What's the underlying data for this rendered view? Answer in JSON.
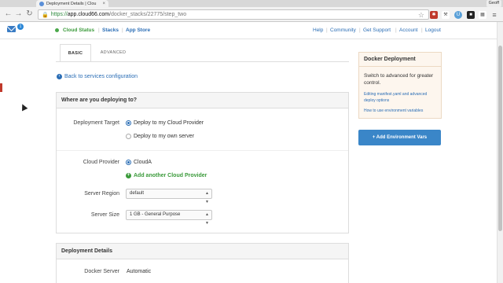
{
  "browser": {
    "tab_title": "Deployment Details | Clou",
    "tab_close": "×",
    "user_name": "Geoff",
    "url_scheme": "https://",
    "url_host": "app.cloud66.com",
    "url_path": "/docker_stacks/22775/step_two"
  },
  "header": {
    "mail_count": "1",
    "left_nav": [
      "Cloud Status",
      "Stacks",
      "App Store"
    ],
    "right_nav": [
      "Help",
      "Community",
      "Get Support",
      "Account",
      "Logout"
    ]
  },
  "tabs": {
    "basic": "BASIC",
    "advanced": "ADVANCED"
  },
  "back_link": "Back to services configuration",
  "deploy_panel": {
    "title": "Where are you deploying to?",
    "target_label": "Deployment Target",
    "target_options": [
      "Deploy to my Cloud Provider",
      "Deploy to my own server"
    ],
    "provider_label": "Cloud Provider",
    "provider_option": "CloudA",
    "add_provider": "Add another Cloud Provider",
    "region_label": "Server Region",
    "region_value": "default",
    "size_label": "Server Size",
    "size_value": "1 GB - General Purpose"
  },
  "details_panel": {
    "title": "Deployment Details",
    "server_label": "Docker Server",
    "server_value": "Automatic"
  },
  "sidebar": {
    "title": "Docker Deployment",
    "text": "Switch to advanced for greater control.",
    "link1": "Editing manifest.yaml and advanced deploy options",
    "link2": "How to use environment variables",
    "env_button": "+ Add Environment Vars"
  },
  "colors": {
    "link": "#2a6db5",
    "success": "#3a9a3a",
    "primary_button": "#3a86c8",
    "sidebar_bg": "#fdf6ee"
  }
}
